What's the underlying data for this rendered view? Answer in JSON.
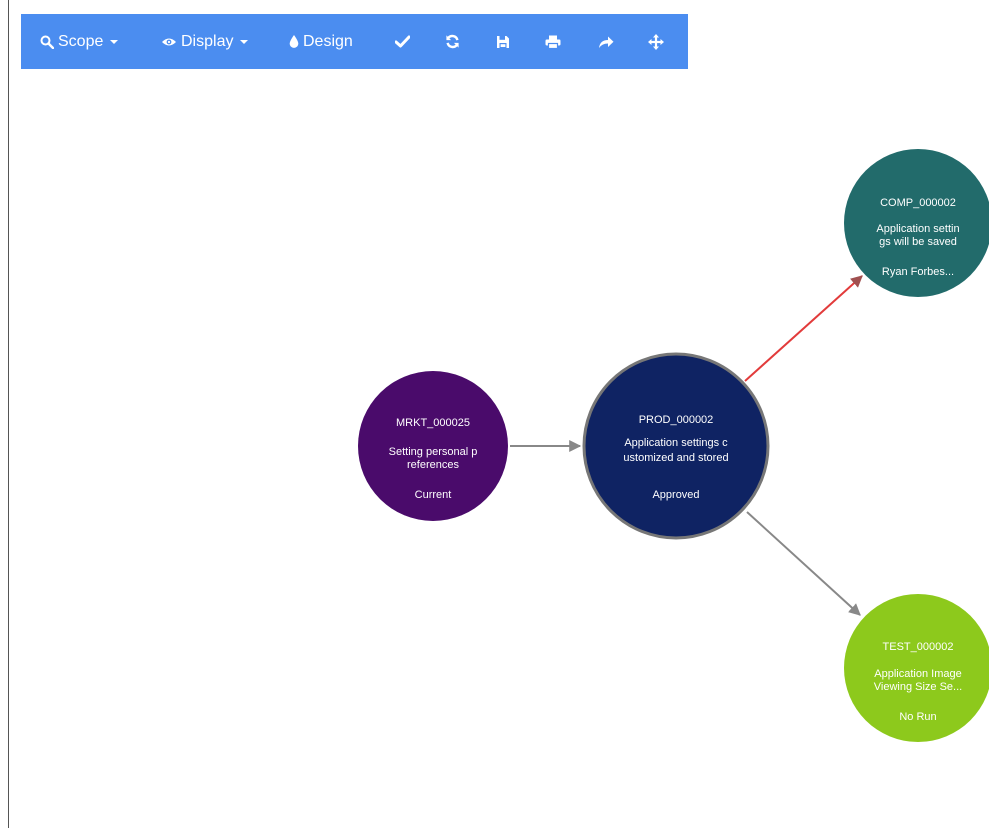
{
  "toolbar": {
    "scope_label": "Scope",
    "display_label": "Display",
    "design_label": "Design",
    "icons": [
      "search-icon",
      "eye-icon",
      "drop-icon",
      "check-icon",
      "refresh-icon",
      "save-icon",
      "print-icon",
      "share-icon",
      "move-icon"
    ],
    "color": "#4b8df0"
  },
  "nodes": [
    {
      "id": "MRKT_000025",
      "lines": [
        "Setting personal p",
        "references"
      ],
      "status": "Current",
      "color": "#4a0b6b"
    },
    {
      "id": "PROD_000002",
      "lines": [
        "Application settings c",
        "ustomized and stored"
      ],
      "status": "Approved",
      "color": "#0f2363"
    },
    {
      "id": "COMP_000002",
      "lines": [
        "Application settin",
        "gs will be saved"
      ],
      "status": "Ryan Forbes...",
      "color": "#226b6b"
    },
    {
      "id": "TEST_000002",
      "lines": [
        "Application Image",
        "Viewing Size Se..."
      ],
      "status": "No Run",
      "color": "#8dc91c"
    }
  ],
  "edges": [
    {
      "from": "MRKT_000025",
      "to": "PROD_000002",
      "color": "#888888"
    },
    {
      "from": "PROD_000002",
      "to": "COMP_000002",
      "color": "#e23b3b"
    },
    {
      "from": "PROD_000002",
      "to": "TEST_000002",
      "color": "#888888"
    }
  ]
}
